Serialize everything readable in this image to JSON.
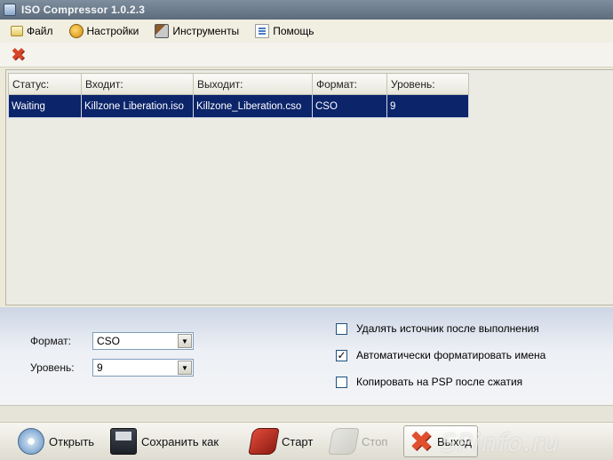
{
  "window": {
    "title": "ISO Compressor 1.0.2.3"
  },
  "menu": {
    "file": "Файл",
    "settings": "Настройки",
    "tools": "Инструменты",
    "help": "Помощь"
  },
  "table": {
    "headers": [
      "Статус:",
      "Входит:",
      "Выходит:",
      "Формат:",
      "Уровень:"
    ],
    "rows": [
      [
        "Waiting",
        "Killzone Liberation.iso",
        "Killzone_Liberation.cso",
        "CSO",
        "9"
      ]
    ]
  },
  "options": {
    "format_label": "Формат:",
    "format_value": "CSO",
    "level_label": "Уровень:",
    "level_value": "9",
    "delete_source": {
      "label": "Удалять источник после выполнения",
      "checked": false
    },
    "auto_format": {
      "label": "Автоматически форматировать имена",
      "checked": true
    },
    "copy_to_psp": {
      "label": "Копировать на PSP после сжатия",
      "checked": false
    }
  },
  "toolbar": {
    "open": "Открыть",
    "save_as": "Сохранить как",
    "start": "Старт",
    "stop": "Стоп",
    "exit": "Выход"
  },
  "watermark": "SPinfo.ru",
  "colors": {
    "selection": "#0b246a",
    "accent": "#e0502f"
  },
  "icons": {
    "remove": "red-x-icon",
    "open": "cd-disc-icon",
    "save": "floppy-disk-icon",
    "start": "red-car-icon",
    "stop": "gray-car-icon",
    "exit": "red-x-icon"
  }
}
